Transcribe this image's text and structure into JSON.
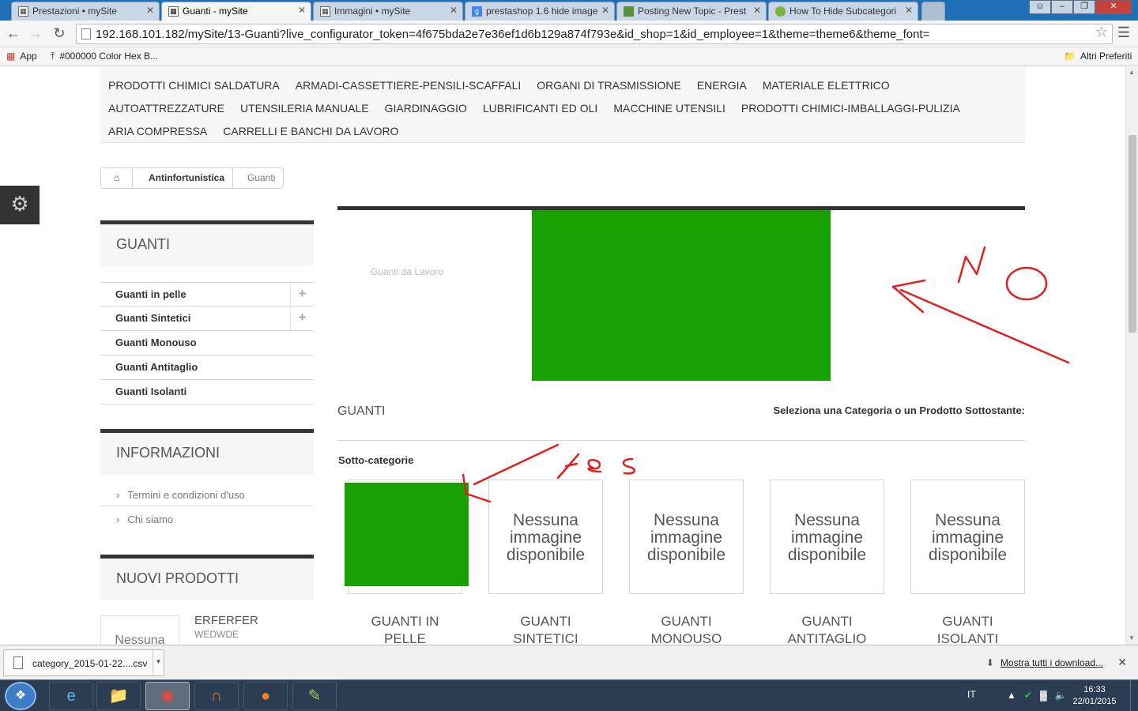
{
  "browser": {
    "tabs": [
      {
        "title": "Prestazioni • mySite",
        "icon": "page-icon",
        "active": false
      },
      {
        "title": "Guanti - mySite",
        "icon": "page-icon",
        "active": true
      },
      {
        "title": "Immagini • mySite",
        "icon": "page-icon",
        "active": false
      },
      {
        "title": "prestashop 1.6 hide image",
        "icon": "google-icon",
        "active": false
      },
      {
        "title": "Posting New Topic - Prest",
        "icon": "forum-icon",
        "active": false
      },
      {
        "title": "How To Hide Subcategori",
        "icon": "forum-icon",
        "active": false
      }
    ],
    "url": "192.168.101.182/mySite/13-Guanti?live_configurator_token=4f675bda2e7e36ef1d6b129a874f793e&id_shop=1&id_employee=1&theme=theme6&theme_font=",
    "bookmarks": [
      {
        "label": "App",
        "icon": "apps-grid-icon"
      },
      {
        "label": "#000000 Color Hex B...",
        "icon": "pin-icon"
      }
    ],
    "other_bookmarks": "Altri Preferiti"
  },
  "site": {
    "top_menu": [
      "PRODOTTI CHIMICI SALDATURA",
      "ARMADI-CASSETTIERE-PENSILI-SCAFFALI",
      "ORGANI DI TRASMISSIONE",
      "ENERGIA",
      "MATERIALE ELETTRICO",
      "AUTOATTREZZATURE",
      "UTENSILERIA MANUALE",
      "GIARDINAGGIO",
      "LUBRIFICANTI ED OLI",
      "MACCHINE UTENSILI",
      "PRODOTTI CHIMICI-IMBALLAGGI-PULIZIA",
      "ARIA COMPRESSA",
      "CARRELLI E BANCHI DA LAVORO"
    ],
    "breadcrumb": [
      "Antinfortunistica",
      "Guanti"
    ],
    "sidebar": {
      "category_title": "GUANTI",
      "categories": [
        {
          "label": "Guanti in pelle",
          "expandable": true
        },
        {
          "label": "Guanti Sintetici",
          "expandable": true
        },
        {
          "label": "Guanti Monouso",
          "expandable": false
        },
        {
          "label": "Guanti Antitaglio",
          "expandable": false
        },
        {
          "label": "Guanti Isolanti",
          "expandable": false
        }
      ],
      "info_title": "INFORMAZIONI",
      "info_links": [
        "Termini e condizioni d'uso",
        "Chi siamo"
      ],
      "new_products_title": "NUOVI PRODOTTI",
      "new_product": {
        "image_text": "Nessuna",
        "name": "ERFERFER",
        "desc": "WEDWDE"
      }
    },
    "main": {
      "banner_text": "Guanti da Lavoro",
      "category_name": "GUANTI",
      "select_hint": "Seleziona una Categoria o un Prodotto Sottostante:",
      "subcategories_title": "Sotto-categorie",
      "no_image_text": [
        "Nessuna",
        "immagine",
        "disponibile"
      ],
      "subcategories": [
        {
          "name_line1": "GUANTI IN",
          "name_line2": "PELLE",
          "has_image": true
        },
        {
          "name_line1": "GUANTI",
          "name_line2": "SINTETICI",
          "has_image": false
        },
        {
          "name_line1": "GUANTI",
          "name_line2": "MONOUSO",
          "has_image": false
        },
        {
          "name_line1": "GUANTI",
          "name_line2": "ANTITAGLIO",
          "has_image": false
        },
        {
          "name_line1": "GUANTI",
          "name_line2": "ISOLANTI",
          "has_image": false
        }
      ],
      "green_color": "#18a100"
    },
    "annotations": {
      "no": "NO",
      "yes": "Yes",
      "color": "#e02020"
    }
  },
  "downloads": {
    "file": "category_2015-01-22....csv",
    "show_all": "Mostra tutti i download..."
  },
  "taskbar": {
    "apps": [
      "internet-explorer-icon",
      "file-explorer-icon",
      "chrome-icon",
      "xampp-icon",
      "firefox-icon",
      "notepad-plus-icon"
    ],
    "lang": "IT",
    "time": "16:33",
    "date": "22/01/2015"
  }
}
